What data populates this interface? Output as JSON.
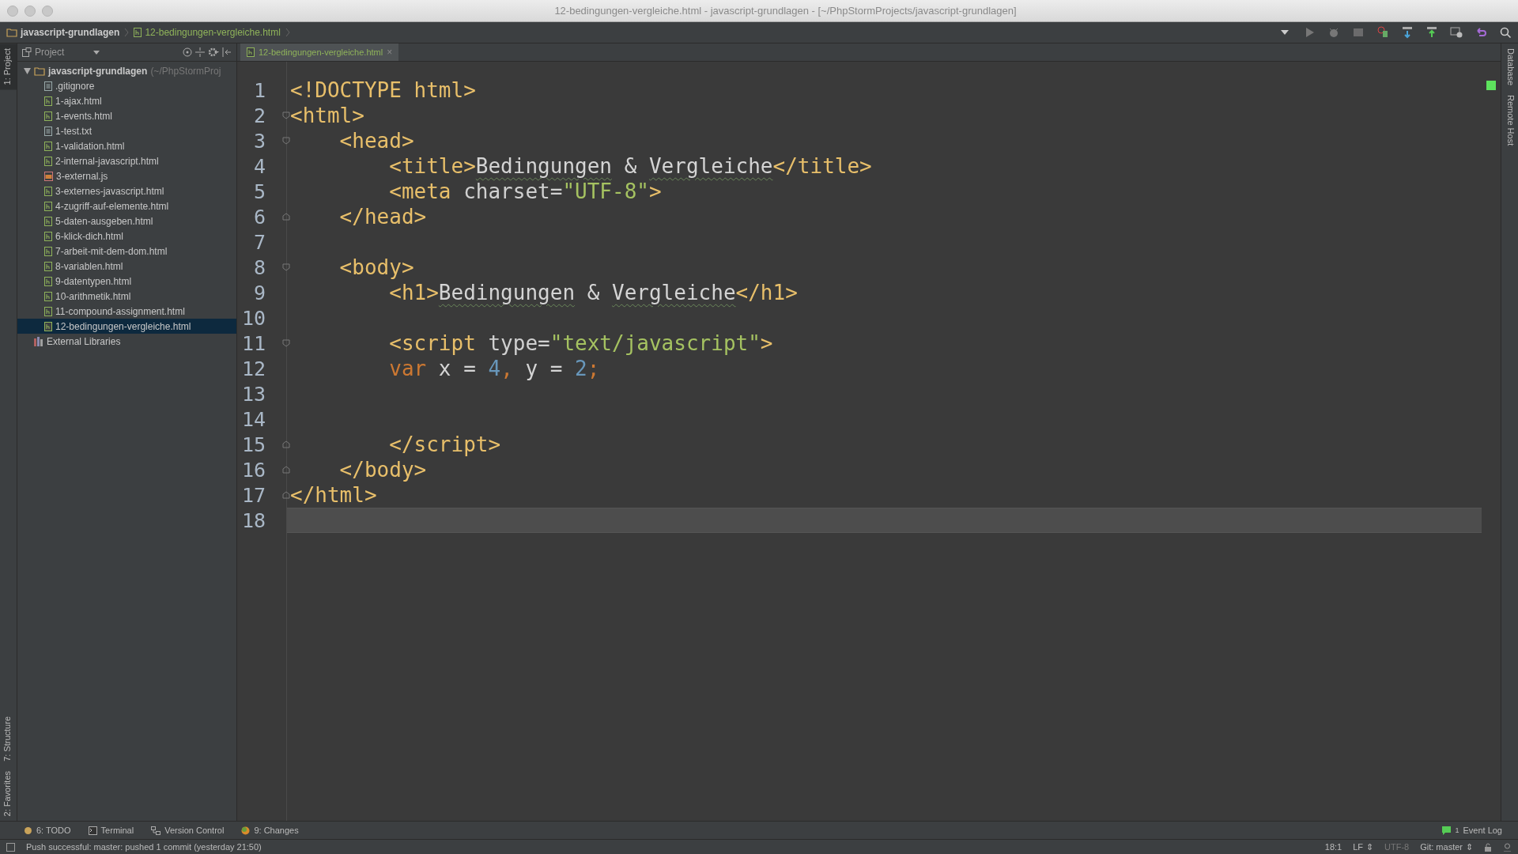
{
  "window": {
    "title": "12-bedingungen-vergleiche.html - javascript-grundlagen - [~/PhpStormProjects/javascript-grundlagen]"
  },
  "breadcrumbs": [
    {
      "label": "javascript-grundlagen",
      "kind": "folder"
    },
    {
      "label": "12-bedingungen-vergleiche.html",
      "kind": "html"
    }
  ],
  "left_strip": [
    {
      "label": "1: Project",
      "selected": true
    },
    {
      "label": "7: Structure",
      "selected": false
    },
    {
      "label": "2: Favorites",
      "selected": false
    }
  ],
  "right_strip": [
    {
      "label": "Database"
    },
    {
      "label": "Remote Host"
    }
  ],
  "project_panel": {
    "title": "Project",
    "tree": [
      {
        "label": "javascript-grundlagen",
        "hint": "(~/PhpStormProj",
        "kind": "folder",
        "expanded": true,
        "selected": false,
        "children": [
          {
            "label": ".gitignore",
            "kind": "text",
            "selected": false
          },
          {
            "label": "1-ajax.html",
            "kind": "html",
            "selected": false
          },
          {
            "label": "1-events.html",
            "kind": "html",
            "selected": false
          },
          {
            "label": "1-test.txt",
            "kind": "text",
            "selected": false
          },
          {
            "label": "1-validation.html",
            "kind": "html",
            "selected": false
          },
          {
            "label": "2-internal-javascript.html",
            "kind": "html",
            "selected": false
          },
          {
            "label": "3-external.js",
            "kind": "js",
            "selected": false
          },
          {
            "label": "3-externes-javascript.html",
            "kind": "html",
            "selected": false
          },
          {
            "label": "4-zugriff-auf-elemente.html",
            "kind": "html",
            "selected": false
          },
          {
            "label": "5-daten-ausgeben.html",
            "kind": "html",
            "selected": false
          },
          {
            "label": "6-klick-dich.html",
            "kind": "html",
            "selected": false
          },
          {
            "label": "7-arbeit-mit-dem-dom.html",
            "kind": "html",
            "selected": false
          },
          {
            "label": "8-variablen.html",
            "kind": "html",
            "selected": false
          },
          {
            "label": "9-datentypen.html",
            "kind": "html",
            "selected": false
          },
          {
            "label": "10-arithmetik.html",
            "kind": "html",
            "selected": false
          },
          {
            "label": "11-compound-assignment.html",
            "kind": "html",
            "selected": false
          },
          {
            "label": "12-bedingungen-vergleiche.html",
            "kind": "html",
            "selected": true
          }
        ]
      },
      {
        "label": "External Libraries",
        "kind": "library",
        "selected": false
      }
    ]
  },
  "editor_tabs": [
    {
      "label": "12-bedingungen-vergleiche.html",
      "close": "×",
      "selected": true
    }
  ],
  "code_lines": [
    {
      "number": "1",
      "current": false,
      "tokens": [
        {
          "kind": "tag",
          "text": "<!DOCTYPE html>"
        }
      ]
    },
    {
      "number": "2",
      "fold_start": true,
      "current": false,
      "tokens": [
        {
          "kind": "tag",
          "text": "<html>"
        }
      ]
    },
    {
      "number": "3",
      "fold_start": true,
      "current": false,
      "tokens": [
        {
          "kind": "tag",
          "text": "    <head>"
        }
      ]
    },
    {
      "number": "4",
      "current": false,
      "tokens": [
        {
          "kind": "tag",
          "text": "        <title>"
        },
        {
          "kind": "typo",
          "text": "Bedingungen"
        },
        {
          "kind": "text",
          "text": " & "
        },
        {
          "kind": "typo",
          "text": "Vergleiche"
        },
        {
          "kind": "tag",
          "text": "</title>"
        }
      ]
    },
    {
      "number": "5",
      "current": false,
      "tokens": [
        {
          "kind": "tag",
          "text": "        <meta "
        },
        {
          "kind": "attr",
          "text": "charset="
        },
        {
          "kind": "string",
          "text": "\"UTF-8\""
        },
        {
          "kind": "tag",
          "text": ">"
        }
      ]
    },
    {
      "number": "6",
      "fold_end": true,
      "current": false,
      "tokens": [
        {
          "kind": "tag",
          "text": "    </head>"
        }
      ]
    },
    {
      "number": "7",
      "current": false
    },
    {
      "number": "8",
      "fold_start": true,
      "current": false,
      "tokens": [
        {
          "kind": "tag",
          "text": "    <body>"
        }
      ]
    },
    {
      "number": "9",
      "current": false,
      "tokens": [
        {
          "kind": "tag",
          "text": "        <h1>"
        },
        {
          "kind": "typo",
          "text": "Bedingungen"
        },
        {
          "kind": "text",
          "text": " & "
        },
        {
          "kind": "typo",
          "text": "Vergleiche"
        },
        {
          "kind": "tag",
          "text": "</h1>"
        }
      ]
    },
    {
      "number": "10",
      "current": false
    },
    {
      "number": "11",
      "fold_start": true,
      "current": false,
      "tokens": [
        {
          "kind": "tag",
          "text": "        <script "
        },
        {
          "kind": "attr",
          "text": "type="
        },
        {
          "kind": "string",
          "text": "\"text/javascript\""
        },
        {
          "kind": "tag",
          "text": ">"
        }
      ]
    },
    {
      "number": "12",
      "current": false,
      "tokens": [
        {
          "kind": "keyword",
          "text": "        var"
        },
        {
          "kind": "text",
          "text": " x = "
        },
        {
          "kind": "number",
          "text": "4"
        },
        {
          "kind": "keyword",
          "text": ","
        },
        {
          "kind": "text",
          "text": " y = "
        },
        {
          "kind": "number",
          "text": "2"
        },
        {
          "kind": "keyword",
          "text": ";"
        }
      ]
    },
    {
      "number": "13",
      "current": false
    },
    {
      "number": "14",
      "current": false
    },
    {
      "number": "15",
      "fold_end": true,
      "current": false,
      "tokens": [
        {
          "kind": "tag",
          "text": "        </script>"
        }
      ]
    },
    {
      "number": "16",
      "fold_end": true,
      "current": false,
      "tokens": [
        {
          "kind": "tag",
          "text": "    </body>"
        }
      ]
    },
    {
      "number": "17",
      "fold_end": true,
      "current": false,
      "tokens": [
        {
          "kind": "tag",
          "text": "</html>"
        }
      ]
    },
    {
      "number": "18",
      "current": true
    }
  ],
  "tool_windows": [
    {
      "label": "6: TODO",
      "kind": "todo"
    },
    {
      "label": "Terminal",
      "kind": "terminal"
    },
    {
      "label": "Version Control",
      "kind": "vcs"
    },
    {
      "label": "9: Changes",
      "kind": "changes"
    }
  ],
  "event_log": {
    "label": "Event Log",
    "count": "1"
  },
  "status_bar": {
    "message": "Push successful: master: pushed 1 commit (yesterday 21:50)",
    "items": [
      {
        "label": "18:1",
        "disabled": false
      },
      {
        "label": "LF",
        "disabled": false,
        "arrow": "⇕"
      },
      {
        "label": "UTF-8",
        "disabled": true
      },
      {
        "label": "Git: master",
        "disabled": false,
        "arrow": "⇕"
      }
    ]
  }
}
